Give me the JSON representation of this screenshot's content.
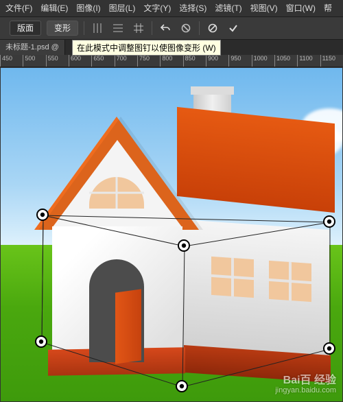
{
  "menu": {
    "file": "文件(F)",
    "edit": "编辑(E)",
    "image": "图像(I)",
    "layer": "图层(L)",
    "type": "文字(Y)",
    "select": "选择(S)",
    "filter": "滤镜(T)",
    "view": "视图(V)",
    "window": "窗口(W)",
    "help": "帮"
  },
  "options": {
    "mode_label": "版面",
    "warp_label": "变形"
  },
  "doc": {
    "tab_title": "未标题-1.psd @"
  },
  "tooltip": {
    "text": "在此模式中调整图钉以使图像变形 (W)"
  },
  "ruler": {
    "ticks": [
      "450",
      "500",
      "550",
      "600",
      "650",
      "700",
      "750",
      "800",
      "850",
      "900",
      "950",
      "1000",
      "1050",
      "1100",
      "1150"
    ]
  },
  "watermark": {
    "brand": "Bai百 经验",
    "url": "jingyan.baidu.com"
  }
}
